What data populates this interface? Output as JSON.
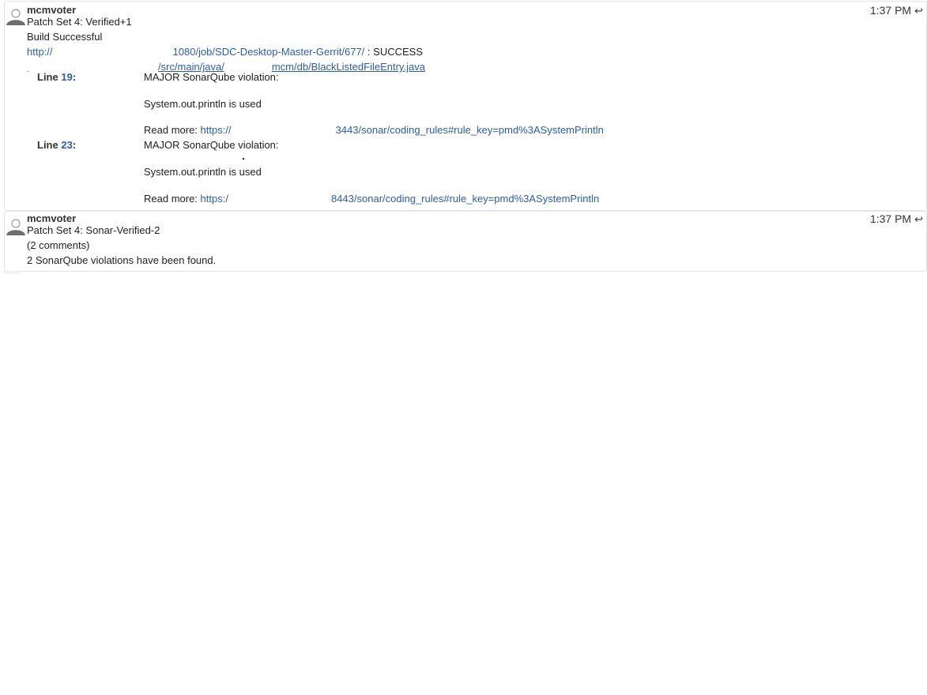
{
  "messages": [
    {
      "author": "mcmvoter",
      "time": "1:37 PM",
      "reply_icon": "reply-arrow-icon",
      "title": "Patch Set 4: Verified+1",
      "lines": [
        "Build Successful",
        "http://",
        "1080/job/SDC-Desktop-Master-Gerrit/677/",
        ": SUCCESS"
      ],
      "file_link_prefix": "/src/main/java/",
      "file_link_suffix": "mcm/db/BlackListedFileEntry.java",
      "comments": [
        {
          "line_label": "Line",
          "line_no": "19",
          "text1": "MAJOR SonarQube violation:",
          "text2": "System.out.println is used",
          "read_more": "Read more:",
          "url_start": "https://",
          "url_end": "3443/sonar/coding_rules#rule_key=pmd%3ASystemPrintln"
        },
        {
          "line_label": "Line",
          "line_no": "23",
          "text1": "MAJOR SonarQube violation:",
          "text2": "System.out.println is used",
          "read_more": "Read more:",
          "url_start": "https:/",
          "url_end": "8443/sonar/coding_rules#rule_key=pmd%3ASystemPrintln"
        }
      ]
    },
    {
      "author": "mcmvoter",
      "time": "1:37 PM",
      "reply_icon": "reply-arrow-icon",
      "title": "Patch Set 4: Sonar-Verified-2",
      "comments_count": "(2 comments)",
      "body": "2 SonarQube violations have been found."
    }
  ]
}
